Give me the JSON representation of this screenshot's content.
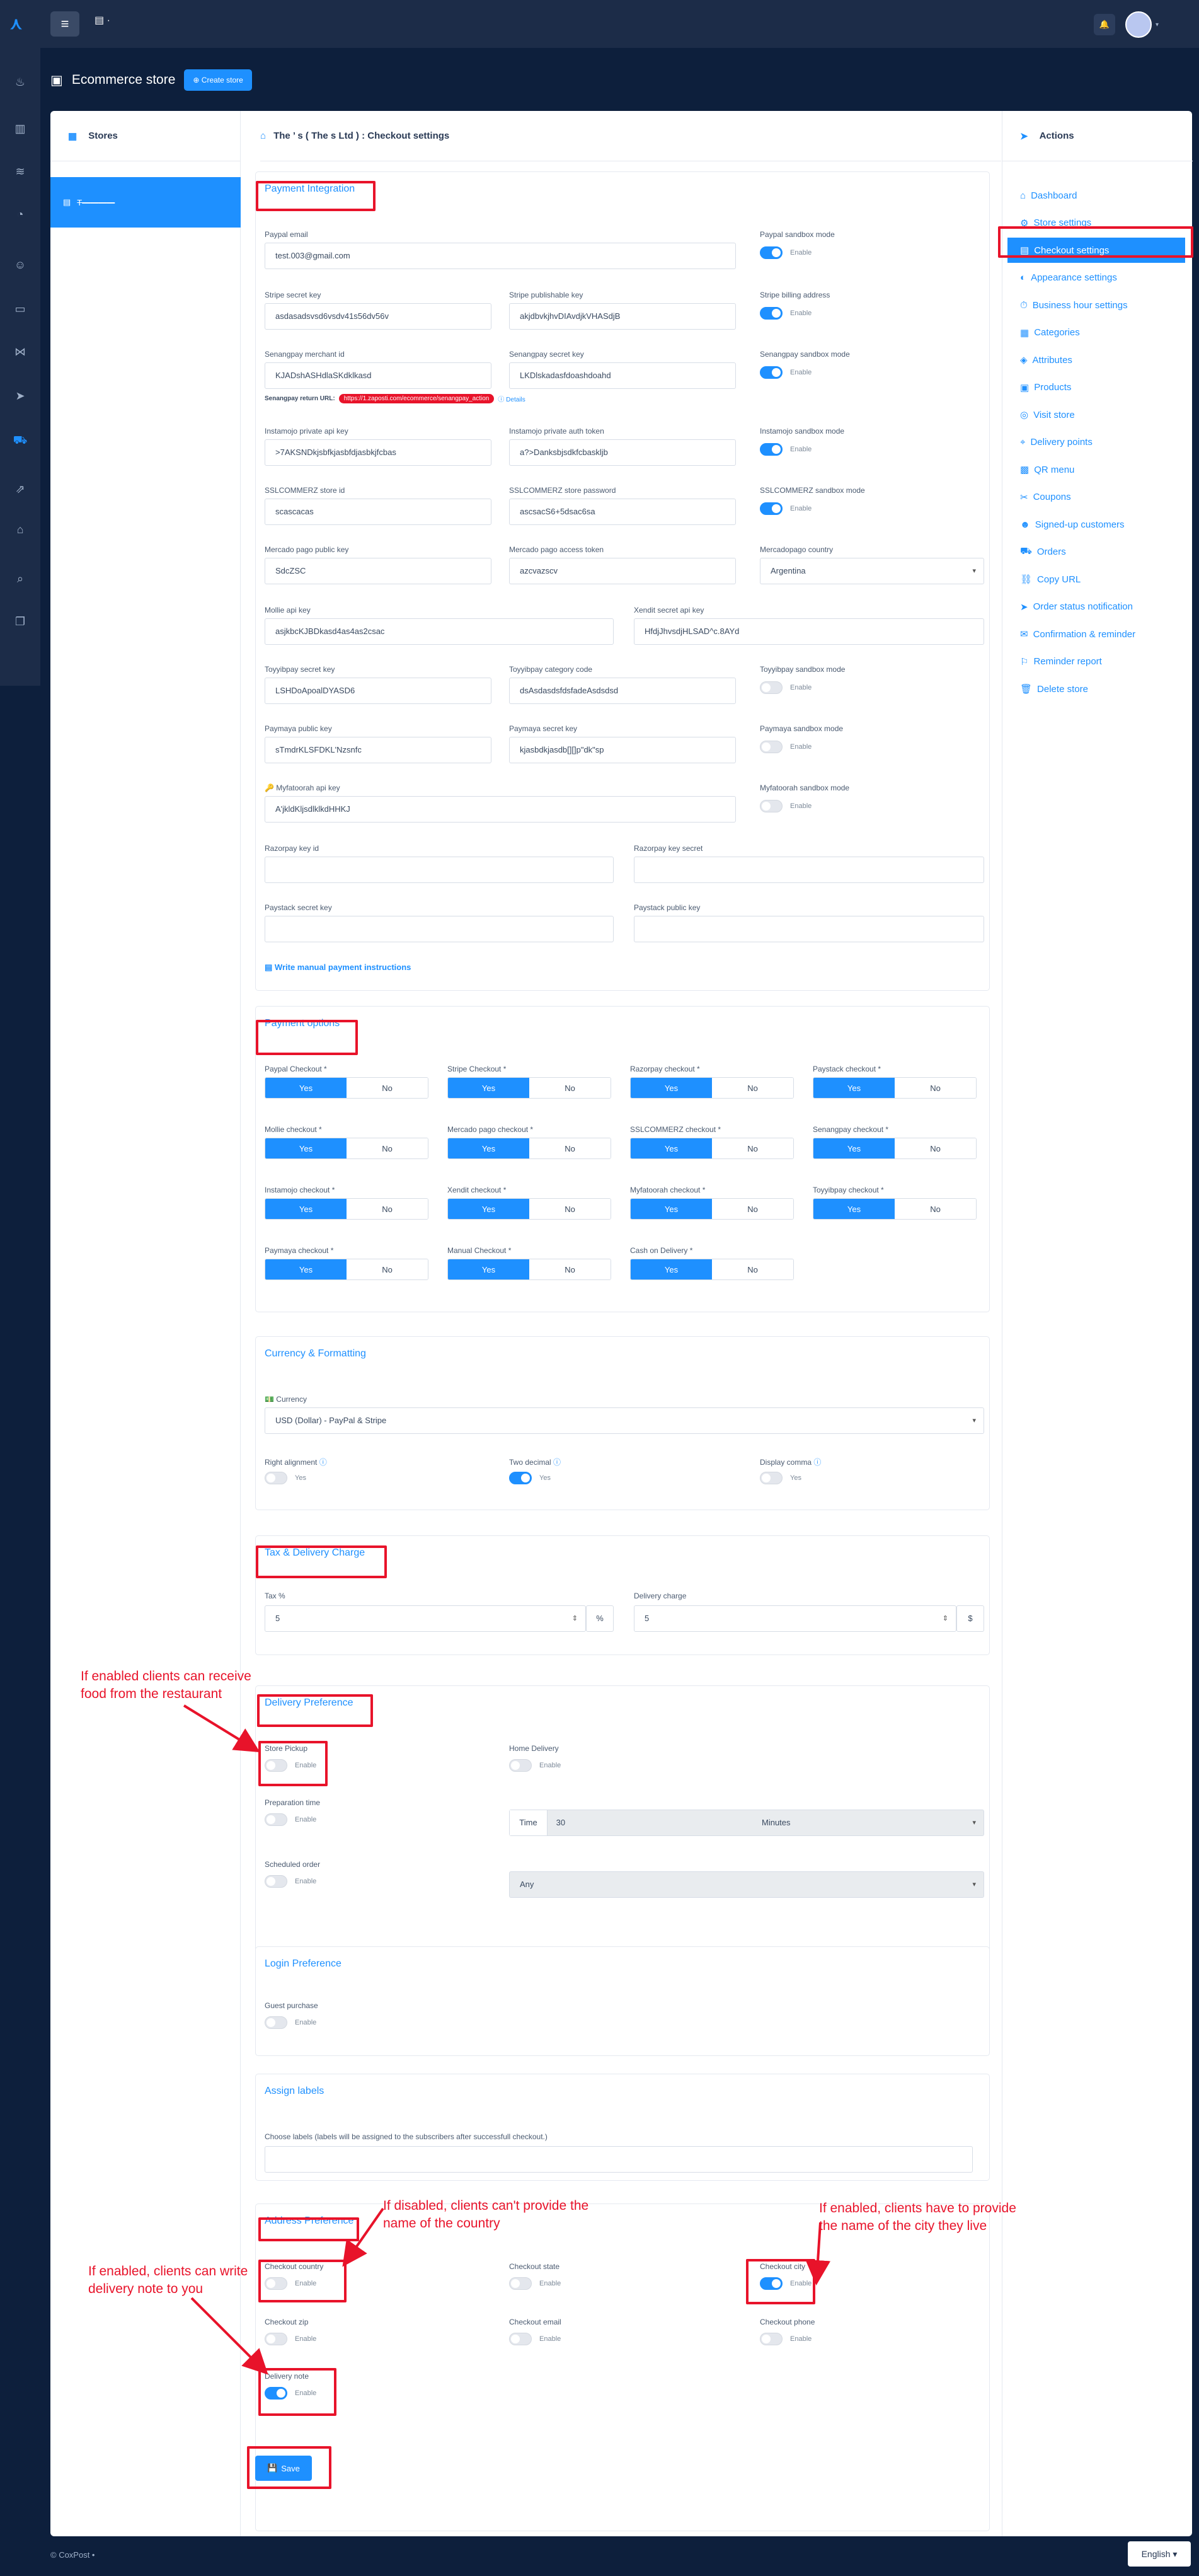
{
  "topbar": {
    "menu_icon": "hamburger-icon",
    "bell_icon": "bell-icon",
    "avatar_icon": "user-avatar-icon"
  },
  "sidebar": {
    "icons": [
      "fire-icon",
      "store-icon",
      "wifi-icon",
      "chat-icon",
      "user-icon",
      "comment-icon",
      "network-icon",
      "send-icon",
      "cart-icon",
      "share-icon",
      "shop-icon",
      "search-icon",
      "files-icon"
    ]
  },
  "header": {
    "title": "Ecommerce store",
    "create_label": "Create store"
  },
  "stores": {
    "title": "Stores",
    "active_store": "T————"
  },
  "breadcrumb": {
    "text": "The   ’   s ( The          s Ltd ) : Checkout settings"
  },
  "actions": {
    "title": "Actions",
    "items": [
      "Dashboard",
      "Store settings",
      "Checkout settings",
      "Appearance settings",
      "Business hour settings",
      "Categories",
      "Attributes",
      "Products",
      "Visit store",
      "Delivery points",
      "QR menu",
      "Coupons",
      "Signed-up customers",
      "Orders",
      "Copy URL",
      "Order status notification",
      "Confirmation & reminder",
      "Reminder report",
      "Delete store"
    ]
  },
  "payment": {
    "title": "Payment Integration",
    "paypal_email_label": "Paypal email",
    "paypal_email": "test.003@gmail.com",
    "paypal_sandbox_label": "Paypal sandbox mode",
    "stripe_secret_label": "Stripe secret key",
    "stripe_secret": "asdasadsvsd6vsdv41s56dv56v",
    "stripe_pub_label": "Stripe publishable key",
    "stripe_pub": "akjdbvkjhvDIAvdjkVHASdjB",
    "stripe_billing_label": "Stripe billing address",
    "senang_merchant_label": "Senangpay merchant id",
    "senang_merchant": "KJADshASHdlaSKdklkasd",
    "senang_secret_label": "Senangpay secret key",
    "senang_secret": "LKDlskadasfdoashdoahd",
    "senang_sandbox_label": "Senangpay sandbox mode",
    "senang_return_label": "Senangpay return URL:",
    "senang_return_url": "https://1.zaposti.com/ecommerce/senangpay_action",
    "senang_details": "Details",
    "insta_private_label": "Instamojo private api key",
    "insta_private": ">7AKSNDkjsbfkjasbfdjasbkjfcbas",
    "insta_auth_label": "Instamojo private auth token",
    "insta_auth": "a?>Danksbjsdkfcbaskljb",
    "insta_sandbox_label": "Instamojo sandbox mode",
    "ssl_id_label": "SSLCOMMERZ store id",
    "ssl_id": "scascacas",
    "ssl_pw_label": "SSLCOMMERZ store password",
    "ssl_pw": "ascsacS6+5dsac6sa",
    "ssl_sandbox_label": "SSLCOMMERZ sandbox mode",
    "mp_pub_label": "Mercado pago public key",
    "mp_pub": "SdcZSC",
    "mp_token_label": "Mercado pago access token",
    "mp_token": "azcvazscv",
    "mp_country_label": "Mercadopago country",
    "mp_country": "Argentina",
    "mollie_label": "Mollie api key",
    "mollie": "asjkbcKJBDkasd4as4as2csac",
    "xendit_label": "Xendit secret api key",
    "xendit": "HfdjJhvsdjHLSAD^c.8AYd",
    "toyyib_key_label": "Toyyibpay secret key",
    "toyyib_key": "LSHDoApoalDYASD6",
    "toyyib_cat_label": "Toyyibpay category code",
    "toyyib_cat": "dsAsdasdsfdsfadeAsdsdsd",
    "toyyib_sandbox_label": "Toyyibpay sandbox mode",
    "paymaya_pub_label": "Paymaya public key",
    "paymaya_pub": "sTmdrKLSFDKL'Nzsnfc",
    "paymaya_secret_label": "Paymaya secret key",
    "paymaya_secret": "kjasbdkjasdb[][]p\"dk\"sp",
    "paymaya_sandbox_label": "Paymaya sandbox mode",
    "myfatoorah_label": "Myfatoorah api key",
    "myfatoorah": "A'jkldKljsdlklkdHHKJ",
    "myfatoorah_sandbox_label": "Myfatoorah sandbox mode",
    "razor_id_label": "Razorpay key id",
    "razor_secret_label": "Razorpay key secret",
    "paystack_secret_label": "Paystack secret key",
    "paystack_pub_label": "Paystack public key",
    "manual_link": "Write manual payment instructions",
    "enable": "Enable"
  },
  "options": {
    "title": "Payment options",
    "yes": "Yes",
    "no": "No",
    "items": [
      "Paypal Checkout *",
      "Stripe Checkout *",
      "Razorpay checkout *",
      "Paystack checkout *",
      "Mollie checkout *",
      "Mercado pago checkout *",
      "SSLCOMMERZ checkout *",
      "Senangpay checkout *",
      "Instamojo checkout *",
      "Xendit checkout *",
      "Myfatoorah checkout *",
      "Toyyibpay checkout *",
      "Paymaya checkout *",
      "Manual Checkout *",
      "Cash on Delivery *"
    ]
  },
  "currency": {
    "title": "Currency & Formatting",
    "currency_label": "Currency",
    "currency_value": "USD (Dollar) - PayPal & Stripe",
    "right_label": "Right alignment",
    "two_label": "Two decimal",
    "comma_label": "Display comma",
    "yes": "Yes"
  },
  "tax": {
    "title": "Tax & Delivery Charge",
    "tax_label": "Tax %",
    "tax_value": "5",
    "pct": "%",
    "delivery_label": "Delivery charge",
    "delivery_value": "5",
    "dollar": "$"
  },
  "delivery": {
    "title": "Delivery Preference",
    "pickup_label": "Store Pickup",
    "home_label": "Home Delivery",
    "prep_label": "Preparation time",
    "time_prefix": "Time",
    "time_value": "30",
    "time_unit": "Minutes",
    "sched_label": "Scheduled order",
    "sched_value": "Any",
    "enable": "Enable"
  },
  "login": {
    "title": "Login Preference",
    "guest_label": "Guest purchase",
    "enable": "Enable"
  },
  "labels": {
    "title": "Assign labels",
    "desc": "Choose labels (labels will be assigned to the subscribers after successfull checkout.)"
  },
  "address": {
    "title": "Address Preference",
    "country_label": "Checkout country",
    "state_label": "Checkout state",
    "city_label": "Checkout city",
    "zip_label": "Checkout zip",
    "email_label": "Checkout email",
    "phone_label": "Checkout phone",
    "note_label": "Delivery note",
    "enable": "Enable"
  },
  "save_label": "Save",
  "notes": {
    "food": "If enabled clients can receive food from the restaurant",
    "country": "If disabled, clients can't provide the name of the country",
    "city": "If enabled, clients have to provide the name of the city they live",
    "note": "If enabled, clients can write delivery note to you"
  },
  "footer": {
    "copyright": "© CoxPost •",
    "language": "English ▾"
  },
  "colors": {
    "accent": "#1e90ff",
    "annotation": "#e8132a",
    "topbar": "#1c2c48"
  }
}
